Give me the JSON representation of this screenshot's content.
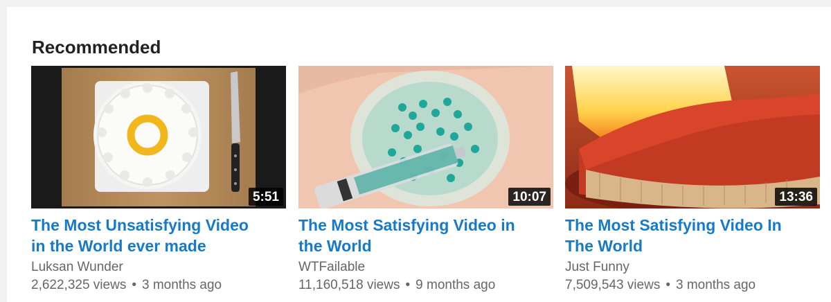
{
  "section": {
    "title": "Recommended"
  },
  "colors": {
    "title_link": "#167ac6",
    "secondary_text": "#666666",
    "section_title": "#222222",
    "background": "#f1f1f1",
    "card_background": "#ffffff"
  },
  "videos": [
    {
      "title": "The Most Unsatisfying Video in the World ever made",
      "channel": "Luksan Wunder",
      "views": "2,622,325 views",
      "separator": "•",
      "age": "3 months ago",
      "duration": "5:51",
      "thumbnail": "cake-and-knife-on-cutting-board"
    },
    {
      "title": "The Most Satisfying Video in the World",
      "channel": "WTFailable",
      "views": "11,160,518 views",
      "separator": "•",
      "age": "9 months ago",
      "duration": "10:07",
      "thumbnail": "syringe-in-gel-ball"
    },
    {
      "title": "The Most Satisfying Video In The World",
      "channel": "Just Funny",
      "views": "7,509,543 views",
      "separator": "•",
      "age": "3 months ago",
      "duration": "13:36",
      "thumbnail": "burning-matches"
    }
  ]
}
